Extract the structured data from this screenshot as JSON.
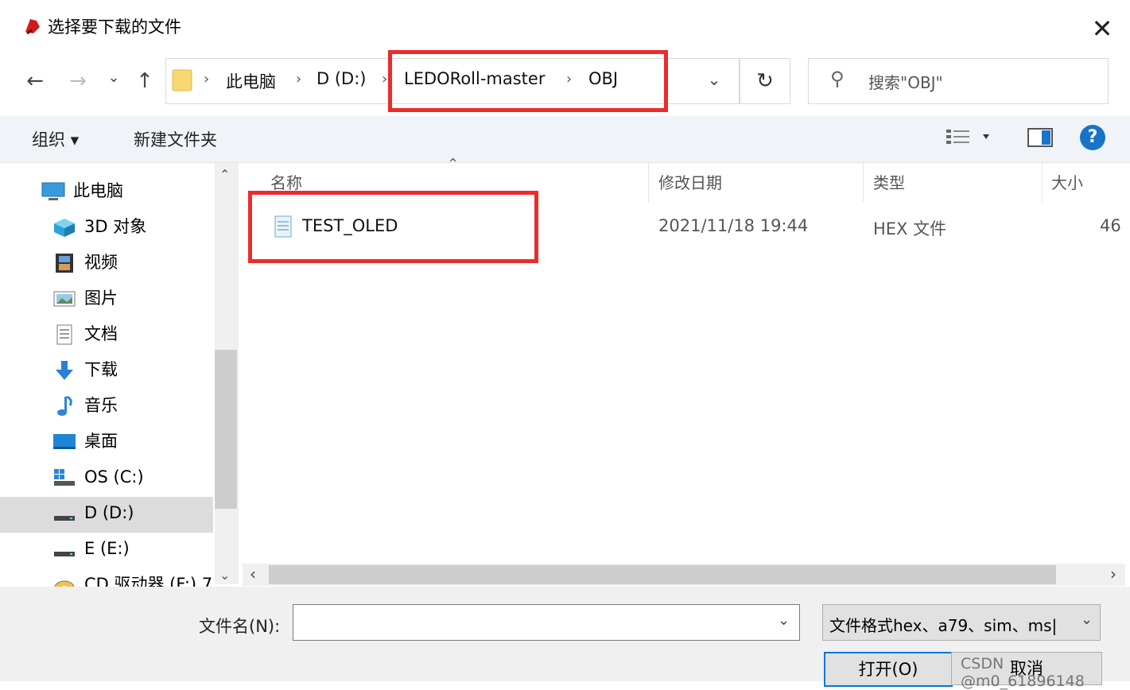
{
  "window": {
    "title": "选择要下载的文件",
    "close_label": "✕"
  },
  "nav": {
    "back": "←",
    "forward": "→",
    "recent": "⌄",
    "up": "↑"
  },
  "address": {
    "crumbs": [
      "此电脑",
      "D (D:)",
      "LEDORoll-master",
      "OBJ"
    ],
    "dropdown": "⌄",
    "refresh": "↻"
  },
  "search": {
    "placeholder": "搜索\"OBJ\""
  },
  "toolbar": {
    "organize": "组织 ▾",
    "new_folder": "新建文件夹",
    "help": "?"
  },
  "navpane": {
    "items": [
      {
        "label": "此电脑",
        "icon": "computer-icon"
      },
      {
        "label": "3D 对象",
        "icon": "cube-icon"
      },
      {
        "label": "视频",
        "icon": "video-icon"
      },
      {
        "label": "图片",
        "icon": "picture-icon"
      },
      {
        "label": "文档",
        "icon": "document-icon"
      },
      {
        "label": "下载",
        "icon": "download-icon"
      },
      {
        "label": "音乐",
        "icon": "music-icon"
      },
      {
        "label": "桌面",
        "icon": "desktop-icon"
      },
      {
        "label": "OS (C:)",
        "icon": "drive-icon"
      },
      {
        "label": "D (D:)",
        "icon": "drive-icon"
      },
      {
        "label": "E (E:)",
        "icon": "drive-icon"
      },
      {
        "label": "CD 驱动器 (F:) 7",
        "icon": "cd-icon"
      }
    ],
    "selected_index": 9
  },
  "list": {
    "columns": [
      "名称",
      "修改日期",
      "类型",
      "大小"
    ],
    "rows": [
      {
        "name": "TEST_OLED",
        "date": "2021/11/18 19:44",
        "type": "HEX 文件",
        "size": "46"
      }
    ]
  },
  "bottom": {
    "filename_label": "文件名(N):",
    "filename_value": "",
    "filter": "文件格式hex、a79、sim、ms|",
    "open": "打开(O)",
    "cancel": "取消",
    "watermark": "CSDN @m0_61896148"
  },
  "colors": {
    "highlight": "#ec2b2b",
    "selected_bg": "#cce4f7",
    "help": "#1a73c9"
  }
}
